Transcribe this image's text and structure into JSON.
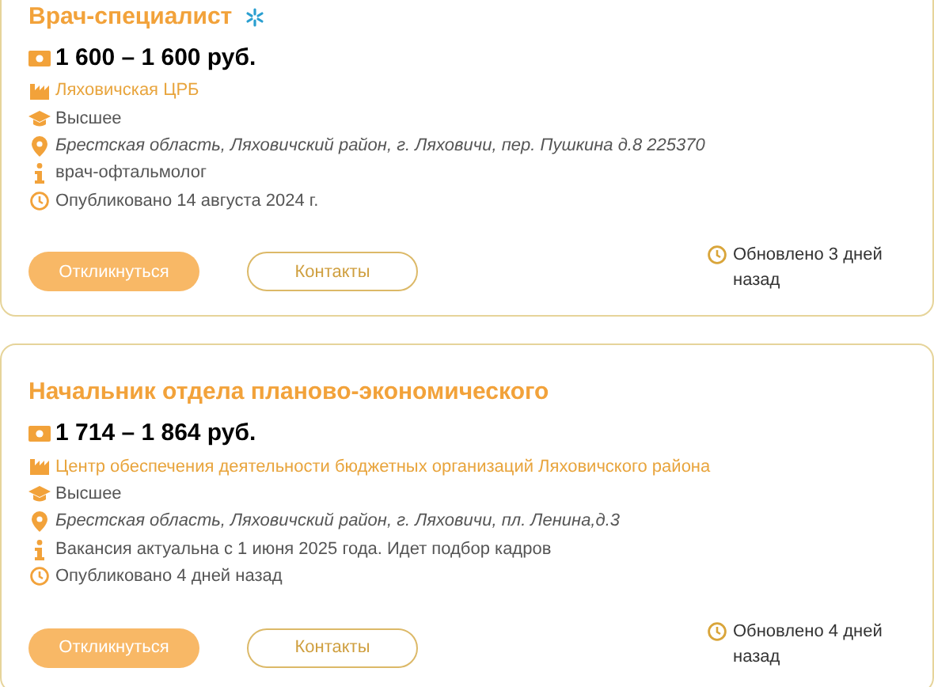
{
  "vacancies": [
    {
      "title": "Врач-специалист",
      "badge": true,
      "details": [
        {
          "kind": "salary",
          "text": "1 600 – 1 600 руб."
        },
        {
          "kind": "organization",
          "text": "Ляховичская ЦРБ"
        },
        {
          "kind": "education",
          "text": "Высшее"
        },
        {
          "kind": "address",
          "text": "Брестская область, Ляховичский район, г. Ляховичи, пер. Пушкина д.8 225370"
        },
        {
          "kind": "info",
          "text": "врач-офтальмолог"
        },
        {
          "kind": "published",
          "text": "Опубликовано 14 августа 2024 г."
        }
      ],
      "buttons": [
        "Откликнуться",
        "Контакты"
      ],
      "updated": "Обновлено 3 дней назад"
    },
    {
      "title": "Начальник отдела планово-экономического",
      "badge": false,
      "details": [
        {
          "kind": "salary",
          "text": "1 714 – 1 864 руб."
        },
        {
          "kind": "organization",
          "text": "Центр обеспечения деятельности бюджетных организаций Ляховичского района"
        },
        {
          "kind": "education",
          "text": "Высшее"
        },
        {
          "kind": "address",
          "text": "Брестская область, Ляховичский район, г. Ляховичи, пл. Ленина,д.3"
        },
        {
          "kind": "info",
          "text": "Вакансия актуальна с 1 июня 2025 года. Идет подбор кадров"
        },
        {
          "kind": "published",
          "text": "Опубликовано 4 дней назад"
        }
      ],
      "buttons": [
        "Откликнуться",
        "Контакты"
      ],
      "updated": "Обновлено 4 дней назад"
    }
  ]
}
